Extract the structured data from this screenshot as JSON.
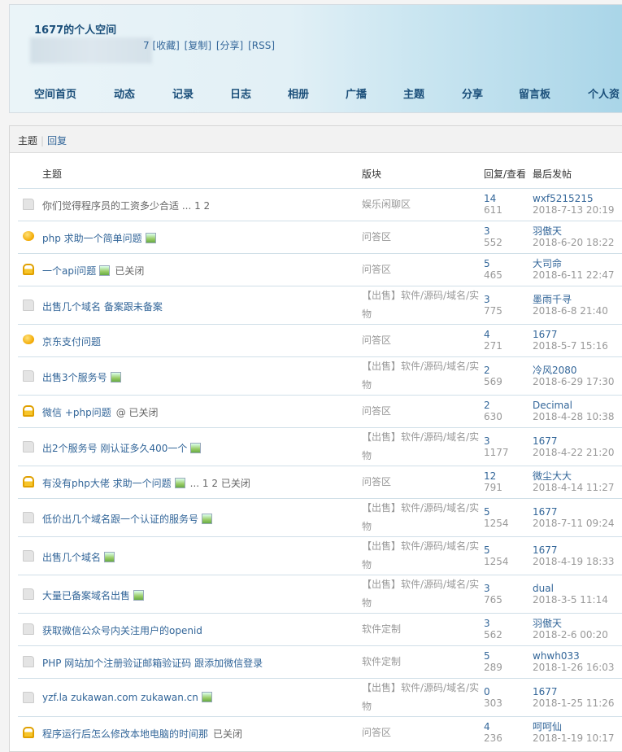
{
  "header": {
    "title": "1677的个人空间",
    "links": [
      "7 [收藏]",
      "[复制]",
      "[分享]",
      "[RSS]"
    ],
    "nav": [
      "空间首页",
      "动态",
      "记录",
      "日志",
      "相册",
      "广播",
      "主题",
      "分享",
      "留言板",
      "个人资"
    ]
  },
  "tabs": [
    "主题",
    "回复"
  ],
  "columns": {
    "topic": "主题",
    "forum": "版块",
    "replies": "回复/查看",
    "last": "最后发帖"
  },
  "rows": [
    {
      "icon": "doc",
      "title": "你们觉得程序员的工资多少合适 ...  1   2",
      "visited": true,
      "forum": "娱乐闲聊区",
      "replies": "14",
      "views": "611",
      "user": "wxf5215215",
      "date": "2018-7-13 20:19"
    },
    {
      "icon": "gold",
      "title": "php 求助一个简单问题",
      "attach": true,
      "forum": "问答区",
      "replies": "3",
      "views": "552",
      "user": "羽傲天",
      "date": "2018-6-20 18:22"
    },
    {
      "icon": "lock",
      "title": "一个api问题",
      "attach": true,
      "extra": "已关闭",
      "forum": "问答区",
      "replies": "5",
      "views": "465",
      "user": "大司命",
      "date": "2018-6-11 22:47"
    },
    {
      "icon": "doc",
      "title": "出售几个域名 备案跟未备案",
      "forum": "【出售】软件/源码/域名/实物",
      "replies": "3",
      "views": "775",
      "user": "墨雨千寻",
      "date": "2018-6-8 21:40"
    },
    {
      "icon": "gold",
      "title": "京东支付问题",
      "forum": "问答区",
      "replies": "4",
      "views": "271",
      "user": "1677",
      "date": "2018-5-7 15:16"
    },
    {
      "icon": "doc",
      "title": "出售3个服务号",
      "attach": true,
      "forum": "【出售】软件/源码/域名/实物",
      "replies": "2",
      "views": "569",
      "user": "冷风2080",
      "date": "2018-6-29 17:30"
    },
    {
      "icon": "lock",
      "title": "微信 +php问题",
      "extra": "@ 已关闭",
      "forum": "问答区",
      "replies": "2",
      "views": "630",
      "user": "Decimal",
      "date": "2018-4-28 10:38"
    },
    {
      "icon": "doc",
      "title": "出2个服务号 刚认证多久400一个",
      "attach": true,
      "forum": "【出售】软件/源码/域名/实物",
      "replies": "3",
      "views": "1177",
      "user": "1677",
      "date": "2018-4-22 21:20"
    },
    {
      "icon": "lock",
      "title": "有没有php大佬 求助一个问题",
      "attach": true,
      "extra": "...  1   2   已关闭",
      "forum": "问答区",
      "replies": "12",
      "views": "791",
      "user": "微尘大大",
      "date": "2018-4-14 11:27"
    },
    {
      "icon": "doc",
      "title": "低价出几个域名跟一个认证的服务号",
      "attach": true,
      "forum": "【出售】软件/源码/域名/实物",
      "replies": "5",
      "views": "1254",
      "user": "1677",
      "date": "2018-7-11 09:24"
    },
    {
      "icon": "doc",
      "title": "出售几个域名",
      "attach": true,
      "forum": "【出售】软件/源码/域名/实物",
      "replies": "5",
      "views": "1254",
      "user": "1677",
      "date": "2018-4-19 18:33"
    },
    {
      "icon": "doc",
      "title": "大量已备案域名出售",
      "attach": true,
      "forum": "【出售】软件/源码/域名/实物",
      "replies": "3",
      "views": "765",
      "user": "dual",
      "date": "2018-3-5 11:14"
    },
    {
      "icon": "doc",
      "title": "获取微信公众号内关注用户的openid",
      "forum": "软件定制",
      "replies": "3",
      "views": "562",
      "user": "羽傲天",
      "date": "2018-2-6 00:20"
    },
    {
      "icon": "doc",
      "title": "PHP 网站加个注册验证邮箱验证码 跟添加微信登录",
      "forum": "软件定制",
      "replies": "5",
      "views": "289",
      "user": "whwh033",
      "date": "2018-1-26 16:03"
    },
    {
      "icon": "doc",
      "title": "yzf.la zukawan.com zukawan.cn",
      "attach": true,
      "forum": "【出售】软件/源码/域名/实物",
      "replies": "0",
      "views": "303",
      "user": "1677",
      "date": "2018-1-25 11:26"
    },
    {
      "icon": "lock",
      "title": "程序运行后怎么修改本地电脑的时间那",
      "extra": "已关闭",
      "forum": "问答区",
      "replies": "4",
      "views": "236",
      "user": "呵呵仙",
      "date": "2018-1-19 10:17"
    }
  ]
}
